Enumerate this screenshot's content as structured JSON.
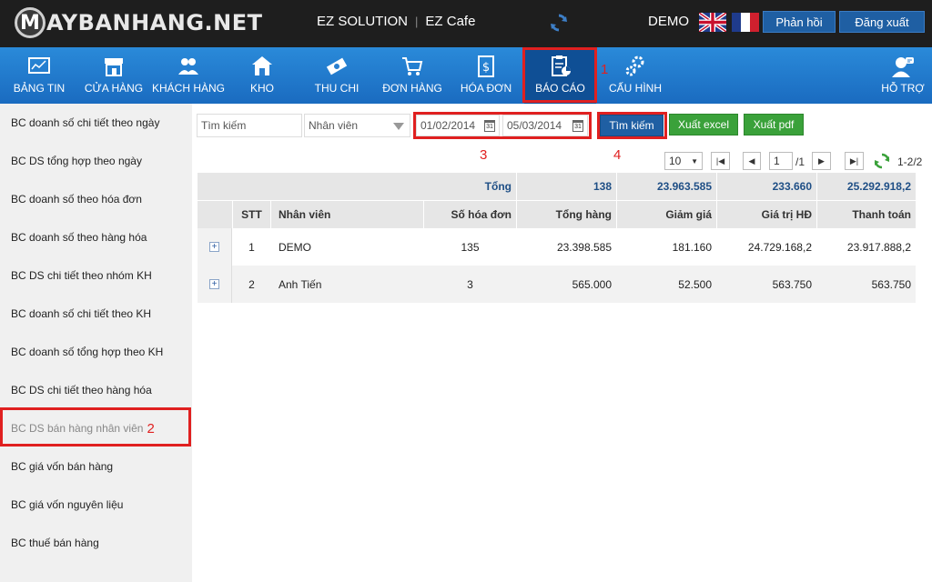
{
  "brand": {
    "logo_letter": "M",
    "logo_text": "AYBANHANG.NET"
  },
  "header": {
    "solution": "EZ SOLUTION",
    "separator": "|",
    "app": "EZ Cafe",
    "user": "DEMO",
    "feedback_label": "Phản hồi",
    "logout_label": "Đăng xuất"
  },
  "nav": {
    "items": [
      {
        "label": "BẢNG TIN",
        "icon": "dashboard-icon"
      },
      {
        "label": "CỬA HÀNG",
        "icon": "store-icon"
      },
      {
        "label": "KHÁCH HÀNG",
        "icon": "customers-icon"
      },
      {
        "label": "KHO",
        "icon": "warehouse-icon"
      },
      {
        "label": "THU CHI",
        "icon": "money-icon"
      },
      {
        "label": "ĐƠN HÀNG",
        "icon": "cart-icon"
      },
      {
        "label": "HÓA ĐƠN",
        "icon": "invoice-icon"
      },
      {
        "label": "BÁO CÁO",
        "icon": "report-icon"
      },
      {
        "label": "CẤU HÌNH",
        "icon": "gears-icon"
      }
    ],
    "support_label": "HỖ TRỢ"
  },
  "annotations": {
    "n1": "1",
    "n2": "2",
    "n3": "3",
    "n4": "4"
  },
  "sidebar": {
    "items": [
      "BC doanh số chi tiết theo ngày",
      "BC DS tổng hợp theo ngày",
      "BC doanh số theo hóa đơn",
      "BC doanh số theo hàng hóa",
      "BC DS chi tiết theo nhóm KH",
      "BC doanh số chi tiết theo KH",
      "BC doanh số tổng hợp theo KH",
      "BC DS chi tiết theo hàng hóa",
      "BC DS bán hàng nhân viên",
      "BC giá vốn bán hàng",
      "BC giá vốn nguyên liệu",
      "BC thuế bán hàng"
    ]
  },
  "filters": {
    "search_placeholder": "Tìm kiếm",
    "employee_value": "Nhân viên",
    "date_from": "01/02/2014",
    "date_to": "05/03/2014",
    "calendar_day": "31",
    "search_button": "Tìm kiếm",
    "excel_button": "Xuất excel",
    "pdf_button": "Xuất pdf"
  },
  "pager": {
    "page_size": "10",
    "current_page": "1",
    "total_pages": "/1",
    "range": "1-2/2"
  },
  "table": {
    "total_label": "Tổng",
    "totals": [
      "138",
      "23.963.585",
      "233.660",
      "25.292.918,2"
    ],
    "columns": [
      "STT",
      "Nhân viên",
      "Số hóa đơn",
      "Tổng hàng",
      "Giảm giá",
      "Giá trị HĐ",
      "Thanh toán"
    ],
    "rows": [
      {
        "stt": "1",
        "employee": "DEMO",
        "invoices": "135",
        "total_goods": "23.398.585",
        "discount": "181.160",
        "invoice_value": "24.729.168,2",
        "payment": "23.917.888,2"
      },
      {
        "stt": "2",
        "employee": "Anh Tiến",
        "invoices": "3",
        "total_goods": "565.000",
        "discount": "52.500",
        "invoice_value": "563.750",
        "payment": "563.750"
      }
    ],
    "expand_symbol": "+"
  },
  "colors": {
    "nav_blue": "#1a6bc0",
    "highlight_red": "#e02020",
    "button_blue": "#1f5fa3",
    "button_green": "#3aa13a"
  }
}
